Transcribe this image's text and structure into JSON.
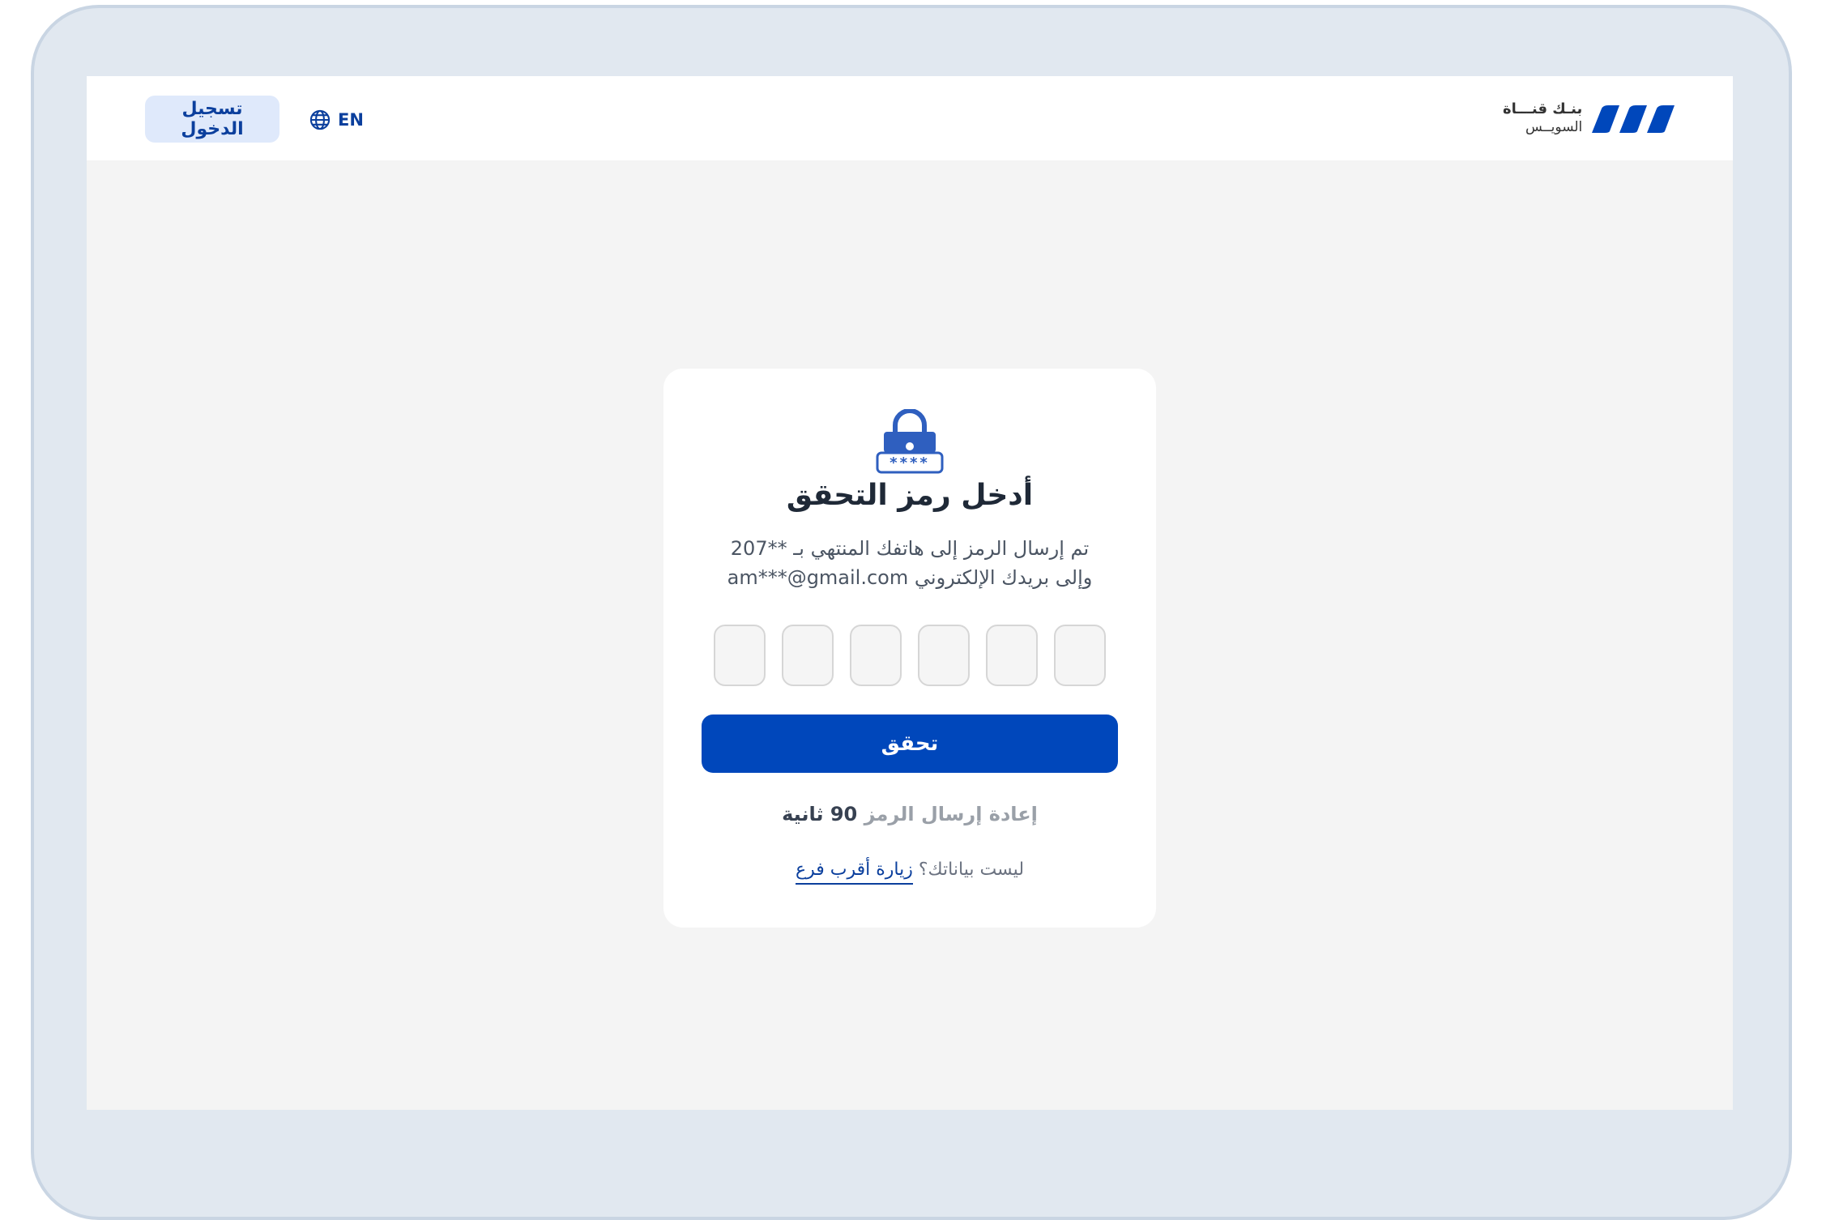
{
  "header": {
    "login_label": "تسجيل الدخول",
    "language_label": "EN",
    "brand_line1": "بنـك قنـــاة",
    "brand_line2": "السويــس"
  },
  "card": {
    "title": "أدخل رمز التحقق",
    "desc_line1": "تم إرسال الرمز إلى هاتفك المنتهي بـ **207",
    "desc_line2": "وإلى بريدك الإلكتروني am***@gmail.com",
    "lock_code": "****",
    "otp_count": 6,
    "verify_label": "تحقق",
    "resend_label": "إعادة إرسال الرمز",
    "resend_timer": "90 ثانية",
    "branch_question": "ليست بياناتك؟",
    "branch_link": "زيارة أقرب فرع"
  },
  "colors": {
    "primary": "#0047bb",
    "primary_dark": "#0b3f9d",
    "login_bg": "#dfe9fb",
    "frame": "#e1e8f0",
    "page_bg": "#f4f4f4"
  },
  "icons": {
    "language": "globe-icon",
    "lock": "lock-icon",
    "brand": "bank-logo-icon"
  }
}
